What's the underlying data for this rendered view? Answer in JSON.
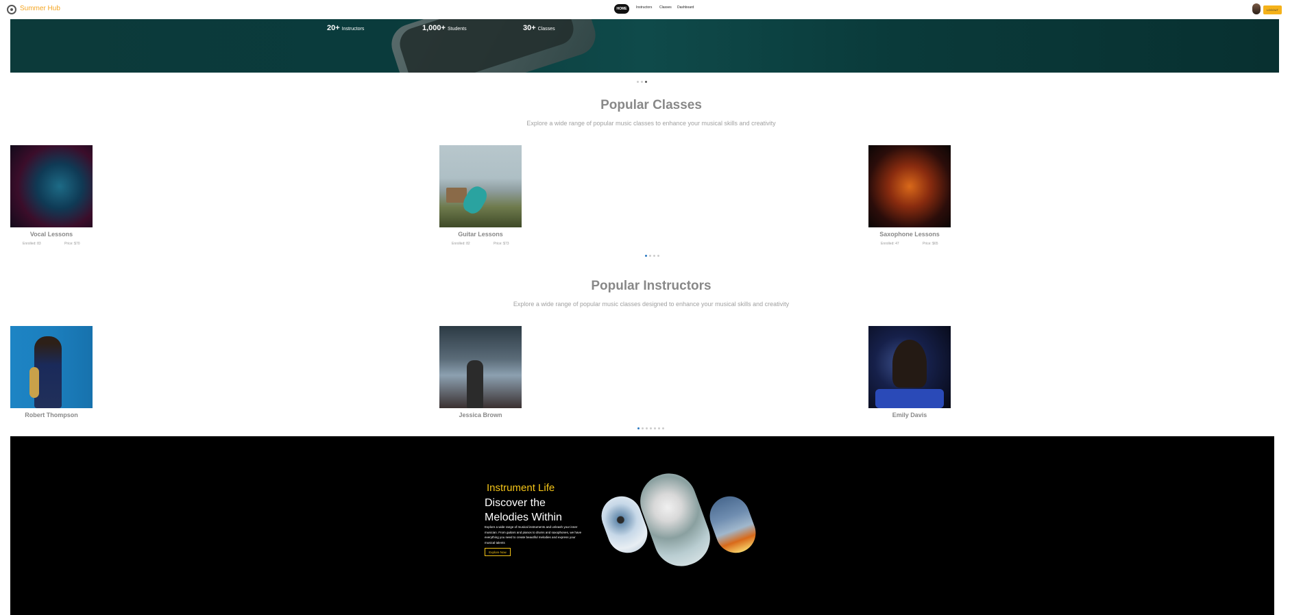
{
  "navbar": {
    "brand": "Summer Hub",
    "links": [
      "HOME",
      "Instructors",
      "Classes",
      "Dashboard"
    ],
    "logout_label": "LOGOUT"
  },
  "hero": {
    "stats": [
      {
        "value": "20+",
        "label": "Instructors"
      },
      {
        "value": "1,000+",
        "label": "Students"
      },
      {
        "value": "30+",
        "label": "Classes"
      }
    ]
  },
  "popular_classes": {
    "title": "Popular Classes",
    "subtitle": "Explore a wide range of popular music classes to enhance your musical skills and creativity",
    "items": [
      {
        "name": "Vocal Lessons",
        "enrolled": "Enrolled: 83",
        "price": "Price: $70"
      },
      {
        "name": "Guitar Lessons",
        "enrolled": "Enrolled: 82",
        "price": "Price: $73"
      },
      {
        "name": "Saxophone Lessons",
        "enrolled": "Enrolled: 47",
        "price": "Price: $65"
      }
    ]
  },
  "popular_instructors": {
    "title": "Popular Instructors",
    "subtitle": "Explore a wide range of popular music classes designed to enhance your musical skills and creativity",
    "items": [
      {
        "name": "Robert Thompson"
      },
      {
        "name": "Jessica Brown"
      },
      {
        "name": "Emily Davis"
      }
    ]
  },
  "banner": {
    "subtitle": "Instrument Life",
    "title_line1": "Discover the",
    "title_line2": "Melodies Within",
    "description": "Explore a wide range of musical instruments and unleash your inner musician. From guitars and pianos to drums and saxophones, we have everything you need to create beautiful melodies and express your musical talents",
    "button_label": "Explore Now"
  },
  "colors": {
    "brand": "#f5a623",
    "accent_yellow": "#f5c518",
    "carousel_active": "#2b79c2"
  }
}
